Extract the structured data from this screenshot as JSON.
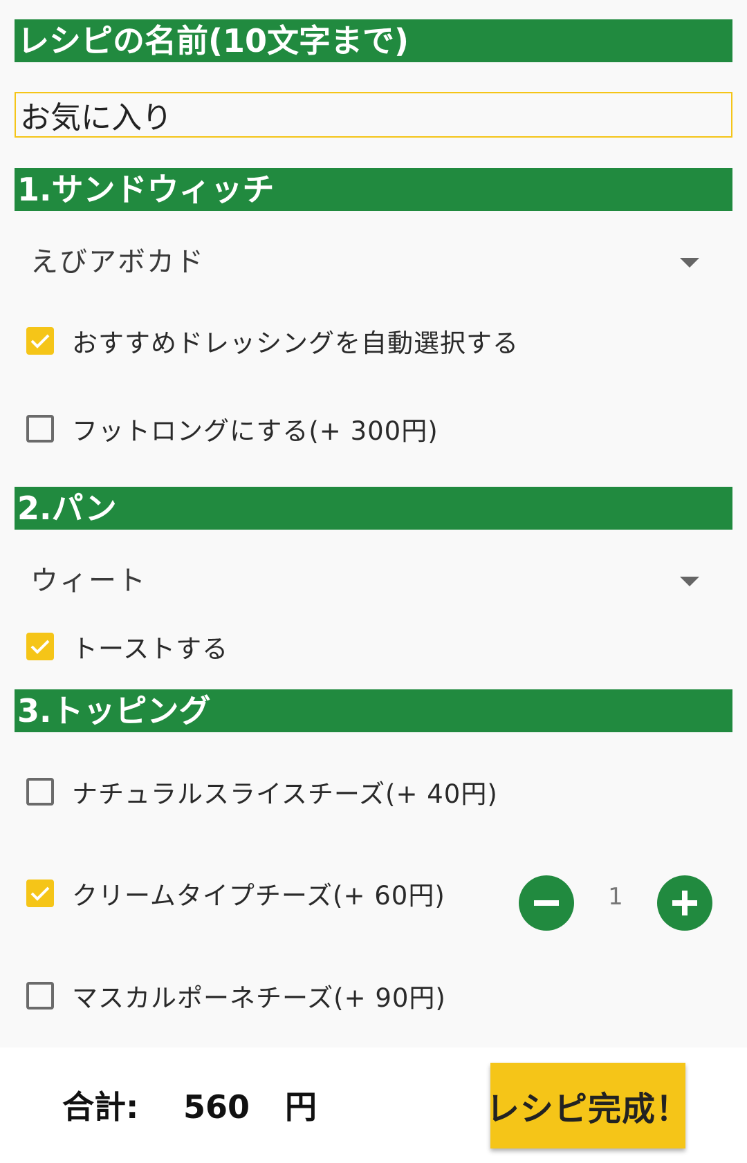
{
  "recipe_name": {
    "heading": "レシピの名前(10文字まで)",
    "value": "お気に入り"
  },
  "sandwich": {
    "heading": "1.サンドウィッチ",
    "selected": "えびアボカド",
    "auto_dressing_label": "おすすめドレッシングを自動選択する",
    "auto_dressing_checked": true,
    "footlong_label": "フットロングにする(+ 300円)",
    "footlong_checked": false
  },
  "bread": {
    "heading": "2.パン",
    "selected": "ウィート",
    "toast_label": "トーストする",
    "toast_checked": true
  },
  "topping": {
    "heading": "3.トッピング",
    "items": [
      {
        "label": "ナチュラルスライスチーズ(+ 40円)",
        "checked": false
      },
      {
        "label": "クリームタイプチーズ(+ 60円)",
        "checked": true,
        "quantity": "1"
      },
      {
        "label": "マスカルポーネチーズ(+ 90円)",
        "checked": false
      }
    ]
  },
  "footer": {
    "total_label": "合計:",
    "total_value": "560",
    "total_unit": "円",
    "complete_button": "レシピ完成！"
  },
  "colors": {
    "header_green": "#218a3f",
    "accent_yellow": "#f5c518",
    "background": "#f9f9f9"
  },
  "icons": {
    "dropdown": "caret-down-icon",
    "check": "checkmark-icon",
    "minus": "minus-icon",
    "plus": "plus-icon"
  }
}
